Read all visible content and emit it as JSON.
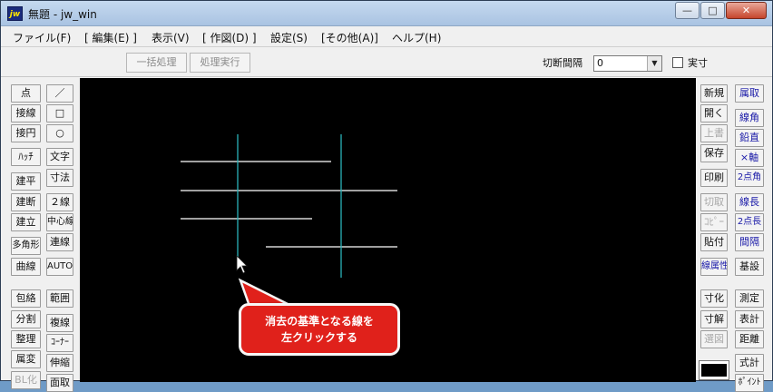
{
  "window": {
    "title": "無題 - jw_win",
    "app_icon": "jw"
  },
  "caption_buttons": {
    "minimize": "—",
    "maximize": "□",
    "close": "✕"
  },
  "menu": [
    "ファイル(F)",
    "[ 編集(E) ]",
    "表示(V)",
    "[ 作図(D) ]",
    "設定(S)",
    "[その他(A)]",
    "ヘルプ(H)"
  ],
  "toolbar": {
    "batch": "一括処理",
    "execute": "処理実行",
    "interval_label": "切断間隔",
    "interval_value": "0",
    "actual_label": "実寸"
  },
  "left_tools": {
    "col1": [
      "点",
      "接線",
      "接円",
      "ﾊｯﾁ",
      "建平",
      "建断",
      "建立",
      "多角形",
      "曲線",
      "包絡",
      "分割",
      "整理",
      "属変",
      "BL化"
    ],
    "col2_symbols": [
      "／",
      "□",
      "○"
    ],
    "col2": [
      "文字",
      "寸法",
      "２線",
      "中心線",
      "連線",
      "AUTO",
      "範囲",
      "複線",
      "ｺｰﾅｰ",
      "伸縮",
      "面取"
    ]
  },
  "right_tools": {
    "col1": [
      "新規",
      "開く",
      "上書",
      "保存",
      "印刷",
      "切取",
      "ｺﾋﾟｰ",
      "貼付",
      "線属性",
      "寸化",
      "寸解",
      "選図"
    ],
    "col2": [
      "属取",
      "線角",
      "鉛直",
      "×軸",
      "2点角",
      "線長",
      "2点長",
      "間隔",
      "基設",
      "測定",
      "表計",
      "距離",
      "式計",
      "ﾎﾟｲﾝﾄ"
    ]
  },
  "callout": {
    "line1": "消去の基準となる線を",
    "line2": "左クリックする"
  },
  "colors": {
    "canvas": "#000000",
    "line_white": "#ffffff",
    "line_cyan": "#2ab3b8",
    "callout": "#e0211b"
  },
  "cursor_icon": "arrow-pointer-icon"
}
